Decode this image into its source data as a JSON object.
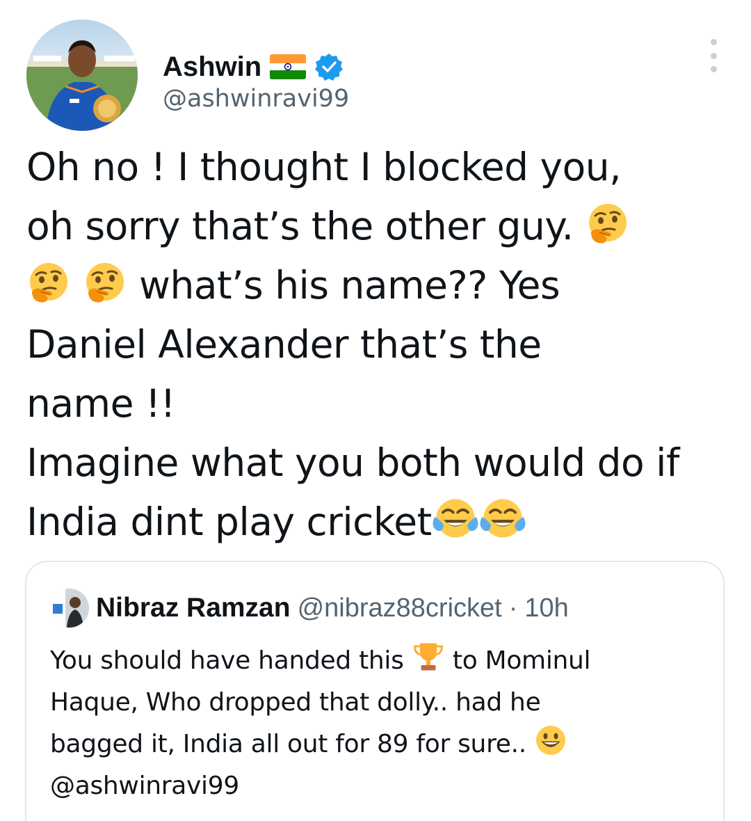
{
  "author": {
    "display_name": "Ashwin",
    "handle": "@ashwinravi99",
    "flag_icon": "india-flag-icon",
    "verified_icon": "verified-badge-icon",
    "verified_color": "#1d9bf0"
  },
  "menu": {
    "icon": "more-options-icon"
  },
  "tweet": {
    "line1": "Oh no ! I thought I blocked you,",
    "line2": "oh sorry that’s the other guy.",
    "line3": "what’s his name?? Yes",
    "line4": "Daniel Alexander that’s the",
    "line5": "name !!",
    "line6": "Imagine what you both would do if",
    "line7": "India dint play cricket",
    "emojis": [
      "thinking-face-icon",
      "thinking-face-icon",
      "thinking-face-icon",
      "tears-of-joy-icon",
      "tears-of-joy-icon"
    ]
  },
  "quote": {
    "name": "Nibraz Ramzan",
    "handle": "@nibraz88cricket",
    "separator": "·",
    "time": "10h",
    "line1_a": "You should have handed this",
    "line1_b": "to Mominul",
    "line2": "Haque, Who dropped that dolly.. had he",
    "line3": "bagged it, India all out for 89 for sure..",
    "line4": "@ashwinravi99",
    "emojis": [
      "trophy-icon",
      "smiley-face-icon"
    ]
  },
  "colors": {
    "text": "#0f1419",
    "secondary": "#536471",
    "border": "#e1e8ed",
    "emoji_yellow": "#ffcb4c"
  }
}
